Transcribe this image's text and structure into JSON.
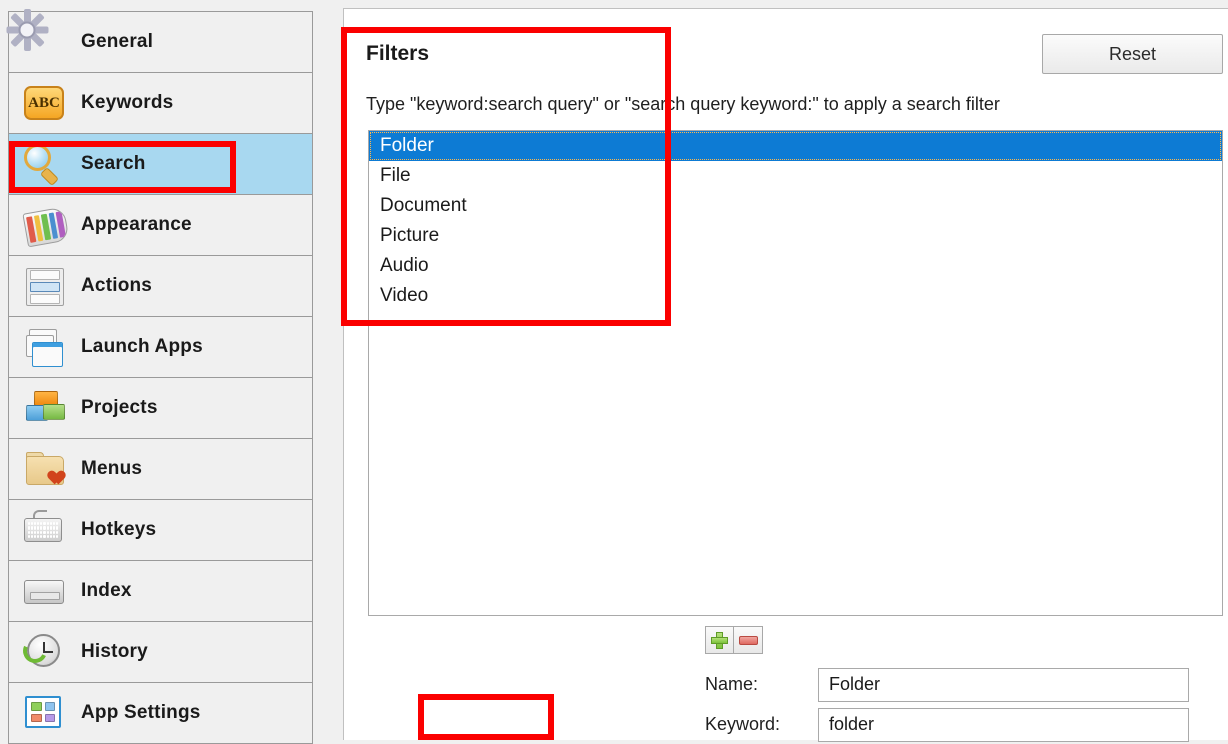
{
  "sidebar": {
    "items": [
      {
        "label": "General",
        "icon": "gear-icon",
        "selected": false
      },
      {
        "label": "Keywords",
        "icon": "abc-icon",
        "selected": false
      },
      {
        "label": "Search",
        "icon": "magnifier-icon",
        "selected": true
      },
      {
        "label": "Appearance",
        "icon": "palette-icon",
        "selected": false
      },
      {
        "label": "Actions",
        "icon": "action-list-icon",
        "selected": false
      },
      {
        "label": "Launch Apps",
        "icon": "windows-stack-icon",
        "selected": false
      },
      {
        "label": "Projects",
        "icon": "bricks-icon",
        "selected": false
      },
      {
        "label": "Menus",
        "icon": "folder-heart-icon",
        "selected": false
      },
      {
        "label": "Hotkeys",
        "icon": "keyboard-icon",
        "selected": false
      },
      {
        "label": "Index",
        "icon": "drive-icon",
        "selected": false
      },
      {
        "label": "History",
        "icon": "clock-refresh-icon",
        "selected": false
      },
      {
        "label": "App Settings",
        "icon": "app-tiles-icon",
        "selected": false
      }
    ]
  },
  "panel": {
    "title": "Filters",
    "reset_label": "Reset",
    "hint": "Type \"keyword:search query\" or \"search query keyword:\" to apply a search filter",
    "filters": [
      {
        "label": "Folder",
        "selected": true
      },
      {
        "label": "File",
        "selected": false
      },
      {
        "label": "Document",
        "selected": false
      },
      {
        "label": "Picture",
        "selected": false
      },
      {
        "label": "Audio",
        "selected": false
      },
      {
        "label": "Video",
        "selected": false
      }
    ],
    "toolbar": {
      "add_label": "+",
      "remove_label": "-"
    },
    "fields": {
      "name_label": "Name:",
      "name_value": "Folder",
      "keyword_label": "Keyword:",
      "keyword_value": "folder"
    }
  },
  "colors": {
    "selection_blue": "#0d7bd4",
    "sidebar_selected": "#a8d8f0",
    "annotation_red": "#fb0000",
    "panel_bg": "#ffffff",
    "app_bg": "#f0f0f0"
  }
}
